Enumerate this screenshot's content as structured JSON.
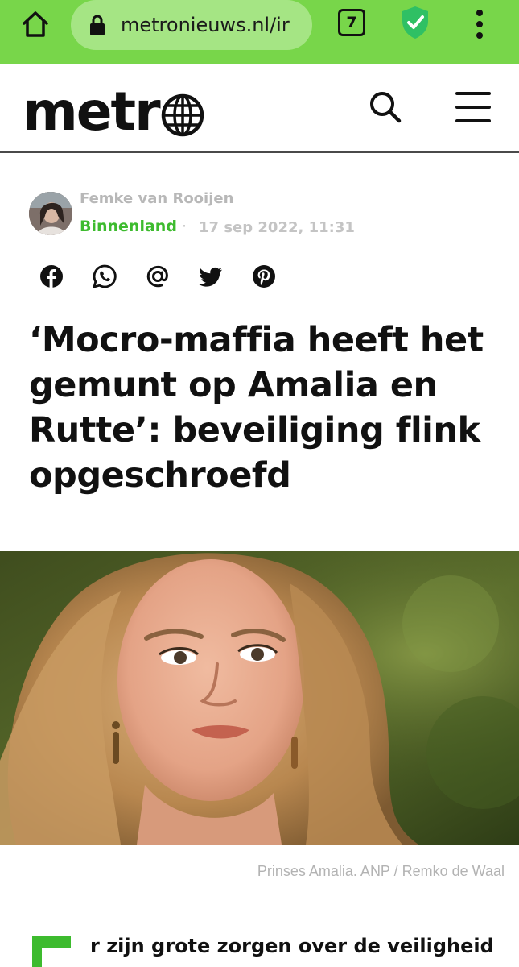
{
  "browser": {
    "url": "metronieuws.nl/ir",
    "tab_count": "7"
  },
  "site": {
    "logo_text": "metr"
  },
  "article": {
    "author": "Femke van Rooijen",
    "category": "Binnenland",
    "separator": "·",
    "date": "17 sep 2022, 11:31",
    "share": [
      "facebook-icon",
      "whatsapp-icon",
      "email-at-icon",
      "twitter-icon",
      "pinterest-icon"
    ],
    "headline": "‘Mocro-maffia heeft het gemunt op Amalia en Rutte’: beveiliging flink opgeschroefd",
    "caption": "Prinses Amalia.  ANP / Remko de Waal",
    "intro": "r zijn grote zorgen over de veiligheid"
  },
  "colors": {
    "browser_bar": "#78d64a",
    "url_pill": "#a5e584",
    "accent_green": "#3dbb2e",
    "shield_green": "#2fc064"
  }
}
